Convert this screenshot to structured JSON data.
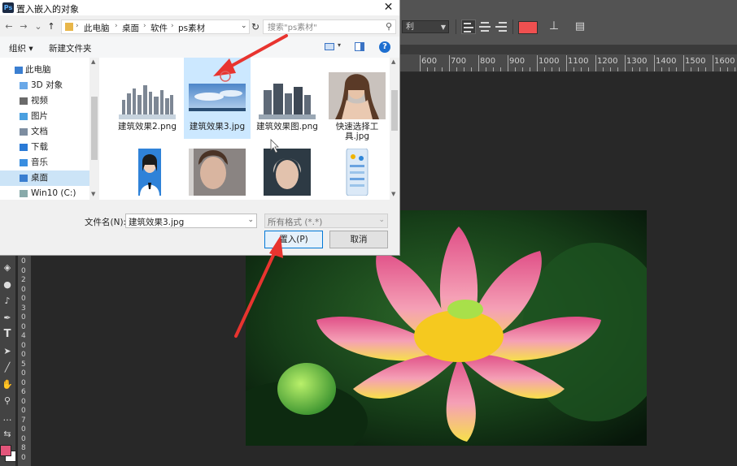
{
  "dialog": {
    "title": "置入嵌入的对象",
    "app_icon_text": "Ps",
    "close_glyph": "✕",
    "nav": {
      "back": "←",
      "forward": "→",
      "history": "⌄",
      "up": "↑",
      "refresh": "↻"
    },
    "breadcrumb": [
      "此电脑",
      "桌面",
      "软件",
      "ps素材"
    ],
    "search_placeholder": "搜索\"ps素材\"",
    "toolbar": {
      "organize": "组织 ▾",
      "new_folder": "新建文件夹",
      "help": "?"
    },
    "nav_tree": [
      {
        "label": "此电脑",
        "icon": "computer-icon",
        "selected": false
      },
      {
        "label": "3D 对象",
        "icon": "3d-objects-icon",
        "selected": false
      },
      {
        "label": "视频",
        "icon": "video-icon",
        "selected": false
      },
      {
        "label": "图片",
        "icon": "pictures-icon",
        "selected": false
      },
      {
        "label": "文档",
        "icon": "documents-icon",
        "selected": false
      },
      {
        "label": "下载",
        "icon": "downloads-icon",
        "selected": false
      },
      {
        "label": "音乐",
        "icon": "music-icon",
        "selected": false
      },
      {
        "label": "桌面",
        "icon": "desktop-icon",
        "selected": true
      },
      {
        "label": "Win10 (C:)",
        "icon": "drive-icon",
        "selected": false
      }
    ],
    "files": [
      {
        "name": "建筑效果2.png",
        "selected": false
      },
      {
        "name": "建筑效果3.jpg",
        "selected": true
      },
      {
        "name": "建筑效果图.png",
        "selected": false
      },
      {
        "name": "快速选择工具.jpg",
        "selected": false
      },
      {
        "name": "",
        "selected": false
      },
      {
        "name": "",
        "selected": false
      },
      {
        "name": "",
        "selected": false
      },
      {
        "name": "",
        "selected": false
      }
    ],
    "footer": {
      "filename_label": "文件名(N):",
      "filename_value": "建筑效果3.jpg",
      "filetype_value": "所有格式 (*.*)",
      "place_button": "置入(P)",
      "cancel_button": "取消"
    }
  },
  "photoshop": {
    "options_select": "利",
    "text_color": "#f05050",
    "ruler_ticks": [
      "600",
      "700",
      "800",
      "900",
      "1000",
      "1100",
      "1200",
      "1300",
      "1400",
      "1500",
      "1600"
    ],
    "vertical_ruler_numbers": [
      "0",
      "0",
      "2",
      "0",
      "0",
      "3",
      "0",
      "0",
      "4",
      "0",
      "0",
      "5",
      "0",
      "0",
      "6",
      "0",
      "0",
      "7",
      "0",
      "0",
      "8",
      "0"
    ],
    "tools": [
      "paint-bucket-icon",
      "blur-icon",
      "dodge-icon",
      "pen-icon",
      "type-icon",
      "path-select-icon",
      "line-icon",
      "hand-icon",
      "zoom-icon",
      "more-icon",
      "swap-colors-icon"
    ],
    "foreground_color": "#e2557a",
    "background_color": "#ffffff"
  }
}
